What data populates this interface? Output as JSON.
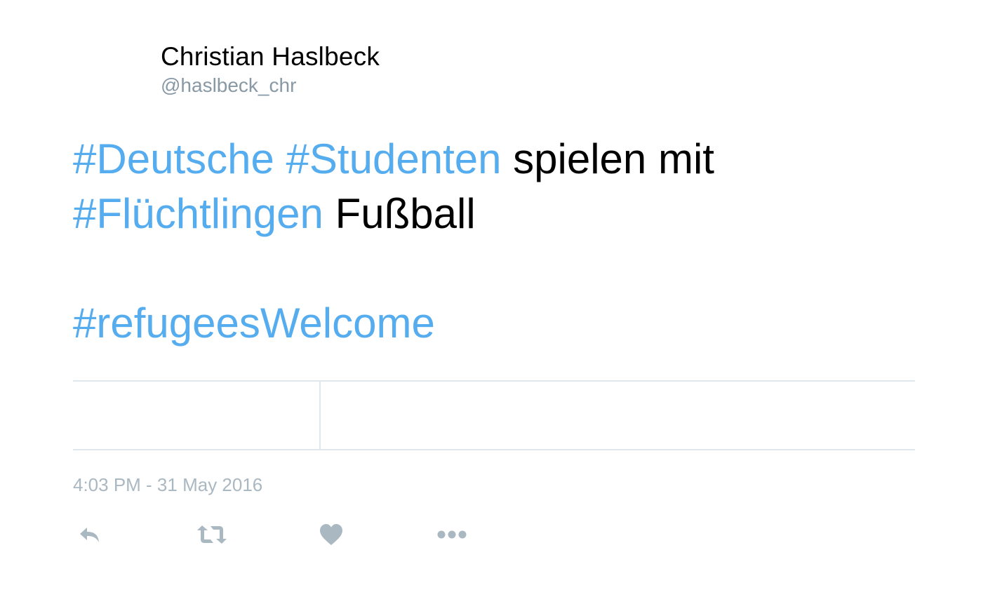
{
  "tweet": {
    "author_name": "Christian Haslbeck",
    "author_handle": "@haslbeck_chr",
    "text_lines": [
      [
        {
          "text": "#Deutsche",
          "type": "hashtag"
        },
        {
          "text": " ",
          "type": "plain"
        },
        {
          "text": "#Studenten",
          "type": "hashtag"
        },
        {
          "text": " spielen mit",
          "type": "plain"
        }
      ],
      [
        {
          "text": "#Flüchtlingen",
          "type": "hashtag"
        },
        {
          "text": " Fußball",
          "type": "plain"
        }
      ],
      [],
      [
        {
          "text": "#refugeesWelcome",
          "type": "hashtag"
        }
      ]
    ],
    "timestamp": "4:03 PM - 31 May 2016"
  },
  "actions": [
    {
      "name": "reply",
      "icon": "reply-icon"
    },
    {
      "name": "retweet",
      "icon": "retweet-icon"
    },
    {
      "name": "like",
      "icon": "heart-icon"
    },
    {
      "name": "more",
      "icon": "more-dots-icon"
    }
  ],
  "colors": {
    "hashtag": "#55acee",
    "text": "#000000",
    "muted": "#8899a6",
    "timestamp": "#aab8c2",
    "icon": "#aab8c2",
    "divider": "#e1e8ed"
  }
}
